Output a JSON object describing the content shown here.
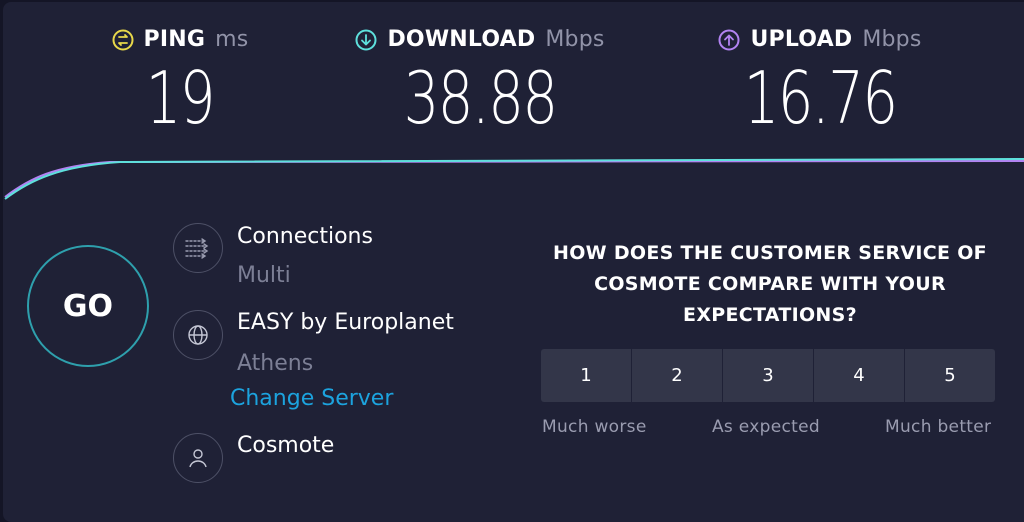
{
  "metrics": {
    "ping": {
      "label": "PING",
      "unit": "ms",
      "value": "19",
      "icon": "ping-icon",
      "color": "#e8d84a"
    },
    "download": {
      "label": "DOWNLOAD",
      "unit": "Mbps",
      "value": "38.88",
      "icon": "download-icon",
      "color": "#5ee0dc"
    },
    "upload": {
      "label": "UPLOAD",
      "unit": "Mbps",
      "value": "16.76",
      "icon": "upload-icon",
      "color": "#b283f2"
    }
  },
  "go_label": "GO",
  "connections": {
    "label": "Connections",
    "value": "Multi",
    "icon": "connections-icon"
  },
  "server": {
    "name": "EASY by Europlanet",
    "location": "Athens",
    "change_label": "Change Server",
    "icon": "globe-icon"
  },
  "provider": {
    "name": "Cosmote",
    "icon": "user-icon"
  },
  "survey": {
    "question": "HOW DOES THE CUSTOMER SERVICE OF COSMOTE COMPARE WITH YOUR EXPECTATIONS?",
    "options": [
      "1",
      "2",
      "3",
      "4",
      "5"
    ],
    "low_label": "Much worse",
    "mid_label": "As expected",
    "high_label": "Much better"
  },
  "colors": {
    "accent": "#1ca3de",
    "background": "#1f2136",
    "graph_download": "#5ee0dc",
    "graph_upload": "#b283f2"
  }
}
